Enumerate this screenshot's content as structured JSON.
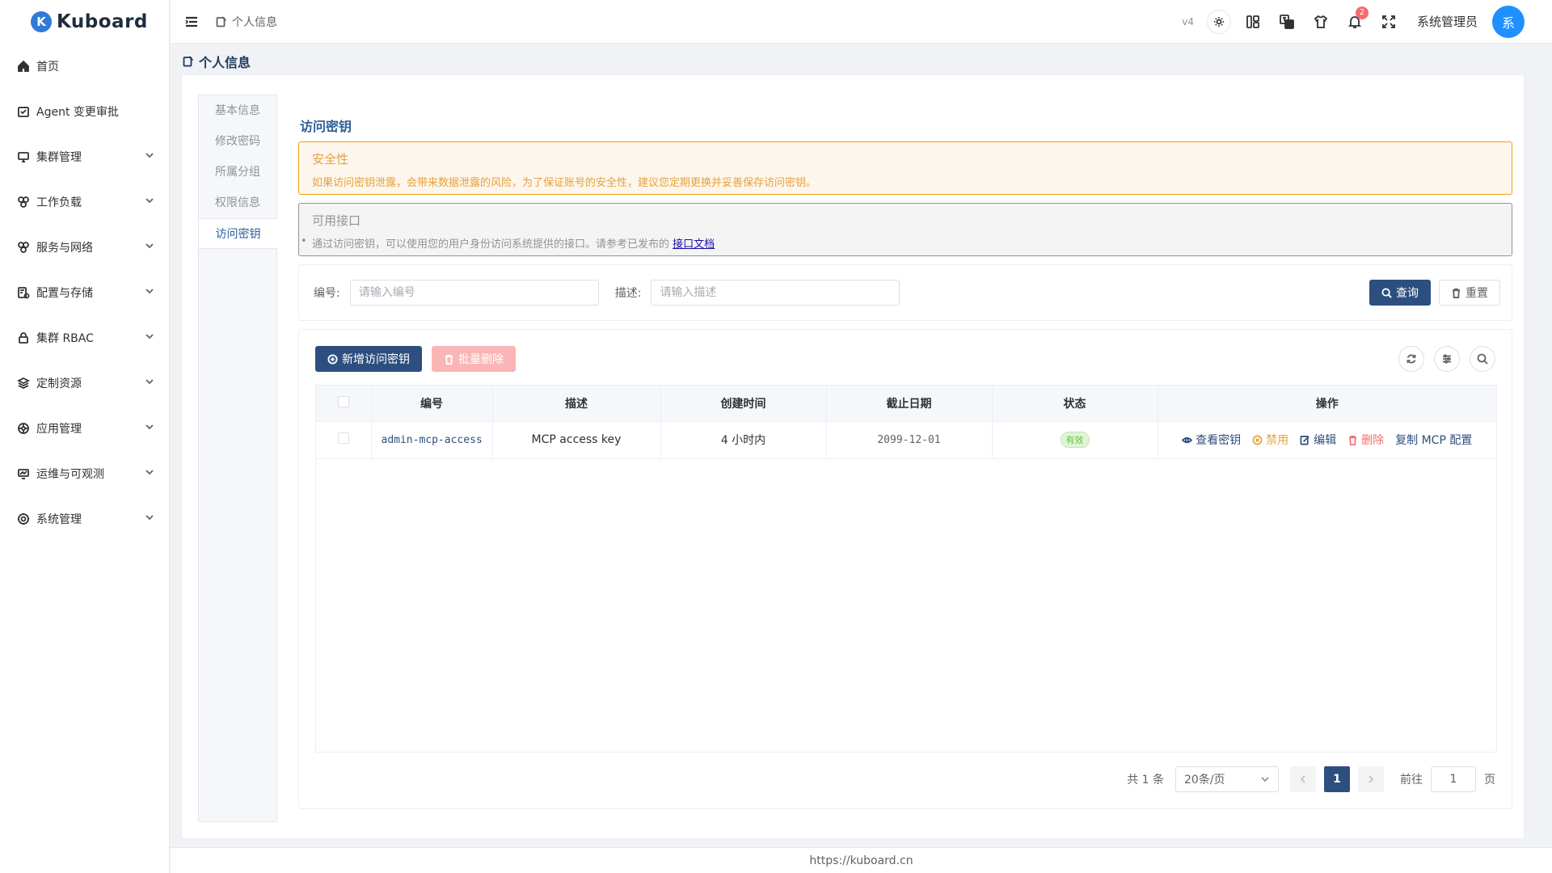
{
  "app": {
    "name": "Kuboard",
    "logo_letter": "K",
    "version": "v4",
    "footer_url": "https://kuboard.cn"
  },
  "header": {
    "breadcrumb": "个人信息",
    "notification_count": "2",
    "username": "系统管理员",
    "avatar_text": "系"
  },
  "sidebar": {
    "items": [
      {
        "label": "首页",
        "icon": "home-icon",
        "expandable": false
      },
      {
        "label": "Agent 变更审批",
        "icon": "approval-icon",
        "expandable": false
      },
      {
        "label": "集群管理",
        "icon": "monitor-icon",
        "expandable": true
      },
      {
        "label": "工作负载",
        "icon": "workload-icon",
        "expandable": true
      },
      {
        "label": "服务与网络",
        "icon": "network-icon",
        "expandable": true
      },
      {
        "label": "配置与存储",
        "icon": "storage-icon",
        "expandable": true
      },
      {
        "label": "集群 RBAC",
        "icon": "lock-icon",
        "expandable": true
      },
      {
        "label": "定制资源",
        "icon": "layers-icon",
        "expandable": true
      },
      {
        "label": "应用管理",
        "icon": "app-icon",
        "expandable": true
      },
      {
        "label": "运维与可观测",
        "icon": "observe-icon",
        "expandable": true
      },
      {
        "label": "系统管理",
        "icon": "gear-icon",
        "expandable": true
      }
    ]
  },
  "page": {
    "title": "个人信息"
  },
  "tabs": [
    {
      "label": "基本信息",
      "active": false
    },
    {
      "label": "修改密码",
      "active": false
    },
    {
      "label": "所属分组",
      "active": false
    },
    {
      "label": "权限信息",
      "active": false
    },
    {
      "label": "访问密钥",
      "active": true
    }
  ],
  "content": {
    "section_title": "访问密钥",
    "warning": {
      "title": "安全性",
      "desc": "如果访问密钥泄露，会带来数据泄露的风险，为了保证账号的安全性，建议您定期更换并妥善保存访问密钥。"
    },
    "info": {
      "title": "可用接口",
      "desc": "通过访问密钥，可以使用您的用户身份访问系统提供的接口。请参考已发布的",
      "link": "接口文档"
    },
    "search": {
      "id_label": "编号:",
      "id_placeholder": "请输入编号",
      "desc_label": "描述:",
      "desc_placeholder": "请输入描述",
      "query_label": "查询",
      "reset_label": "重置"
    },
    "toolbar": {
      "add_label": "新增访问密钥",
      "batch_delete_label": "批量删除"
    },
    "table": {
      "columns": [
        "编号",
        "描述",
        "创建时间",
        "截止日期",
        "状态",
        "操作"
      ],
      "rows": [
        {
          "id": "admin-mcp-access",
          "desc": "MCP access key",
          "created": "4 小时内",
          "expire": "2099-12-01",
          "status": "有效",
          "ops": {
            "view": "查看密钥",
            "disable": "禁用",
            "edit": "编辑",
            "delete": "删除",
            "copy": "复制 MCP 配置"
          }
        }
      ]
    },
    "pager": {
      "total": "共 1 条",
      "page_size": "20条/页",
      "current": "1",
      "goto_label": "前往",
      "goto_value": "1",
      "page_suffix": "页"
    }
  }
}
